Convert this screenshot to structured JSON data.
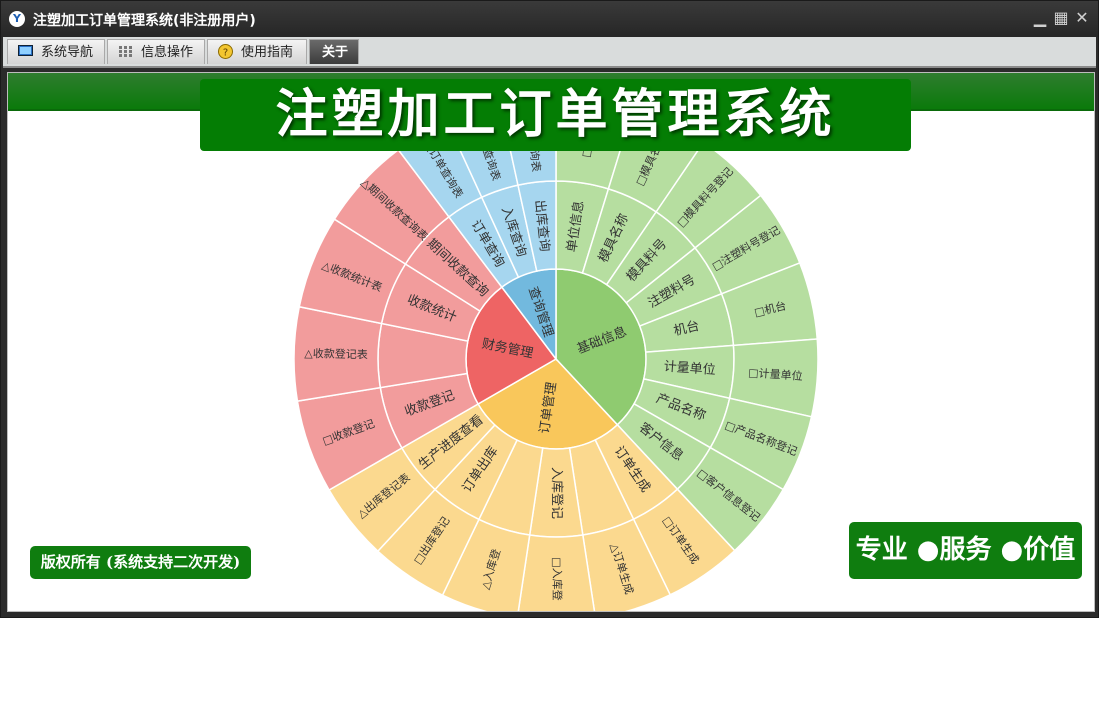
{
  "window": {
    "title": "注塑加工订单管理系统(非注册用户)",
    "app_icon": "y-logo-icon",
    "controls": [
      "minimize-icon",
      "restore-icon",
      "close-icon"
    ]
  },
  "menu": {
    "tabs": [
      {
        "label": "系统导航",
        "icon": "monitor-icon",
        "active": false
      },
      {
        "label": "信息操作",
        "icon": "grid-icon",
        "active": false
      },
      {
        "label": "使用指南",
        "icon": "help-icon",
        "active": false
      },
      {
        "label": "关于",
        "icon": "",
        "active": true
      }
    ]
  },
  "banner": {
    "title": "注塑加工订单管理系统"
  },
  "footer": {
    "copyright": "版权所有 (系统支持二次开发)",
    "slogan": "专业 ●服务 ●价值"
  },
  "colors": {
    "green_brand": "#047d04",
    "basic_info": "#8fcb70",
    "basic_info_light": "#b6dea0",
    "query": "#72b9de",
    "query_light": "#a6d6ef",
    "finance": "#ee6464",
    "finance_light": "#f29c9c",
    "order": "#f9c75b",
    "order_light": "#fbd98f"
  },
  "sunburst": {
    "segments": [
      {
        "label": "基础信息",
        "children": [
          {
            "label": "单位信息",
            "leaf": "□单位"
          },
          {
            "label": "模具名称",
            "leaf": "□模具名称"
          },
          {
            "label": "模具料号",
            "leaf": "□模具料号登记"
          },
          {
            "label": "注塑料号",
            "leaf": "□注塑料号登记"
          },
          {
            "label": "机台",
            "leaf": "□机台"
          },
          {
            "label": "计量单位",
            "leaf": "□计量单位"
          },
          {
            "label": "产品名称",
            "leaf": "□产品名称登记"
          },
          {
            "label": "客户信息",
            "leaf": "□客户信息登记"
          }
        ]
      },
      {
        "label": "订单管理",
        "children": [
          {
            "label": "订单生成",
            "leaf": "□订单生成"
          },
          {
            "label": "",
            "leaf": "△订单生成"
          },
          {
            "label": "入库登记",
            "leaf": "□入库登"
          },
          {
            "label": "",
            "leaf": "△入库登"
          },
          {
            "label": "订单出库",
            "leaf": "□出库登记"
          },
          {
            "label": "生产进度查看",
            "leaf": "△出库登记表"
          }
        ]
      },
      {
        "label": "财务管理",
        "children": [
          {
            "label": "收款登记",
            "leaf": "□收款登记"
          },
          {
            "label": "",
            "leaf": "△收款登记表"
          },
          {
            "label": "收款统计",
            "leaf": "△收款统计表"
          },
          {
            "label": "期间收款查询",
            "leaf": "△期间收款查询表"
          }
        ]
      },
      {
        "label": "查询管理",
        "children": [
          {
            "label": "订单查询",
            "leaf": "△订单查询表"
          },
          {
            "label": "入库查询",
            "leaf": "△入库查询表"
          },
          {
            "label": "出库查询",
            "leaf": "△出库查询表"
          }
        ]
      }
    ]
  }
}
